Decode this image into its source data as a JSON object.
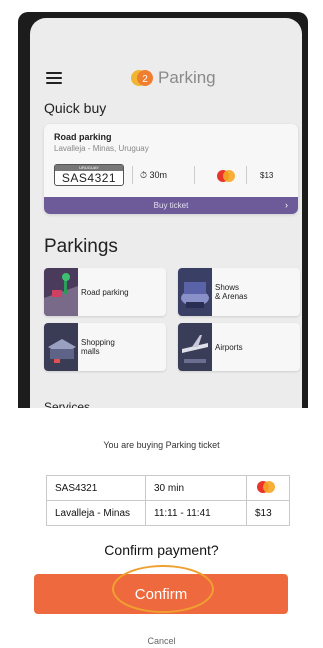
{
  "app": {
    "brand": "Parking",
    "logo_text": "T2",
    "brand_color": "#f39c2a"
  },
  "quick_buy": {
    "title": "Quick buy",
    "card": {
      "title": "Road parking",
      "subtitle": "Lavalleja - Minas, Uruguay",
      "plate_country": "URUGUAY",
      "plate": "SAS4321",
      "duration": "30m",
      "price": "$13",
      "buy_label": "Buy ticket"
    }
  },
  "parkings": {
    "title": "Parkings",
    "tiles": [
      {
        "label": "Road parking",
        "icon": "road-parking-illustration"
      },
      {
        "label": "Shows\n& Arenas",
        "icon": "arena-illustration"
      },
      {
        "label": "Shopping\nmalls",
        "icon": "mall-illustration"
      },
      {
        "label": "Airports",
        "icon": "airport-illustration"
      }
    ]
  },
  "services": {
    "title": "Services"
  },
  "sheet": {
    "title": "You are buying Parking ticket",
    "rows": [
      {
        "c1": "SAS4321",
        "c2": "30 min",
        "c3": ""
      },
      {
        "c1": "Lavalleja - Minas",
        "c2": "11:11 - 11:41",
        "c3": "$13"
      }
    ],
    "question": "Confirm payment?",
    "confirm_label": "Confirm",
    "cancel_label": "Cancel"
  },
  "colors": {
    "accent": "#ee6a3e",
    "buy_button": "#6c5a99",
    "highlight_ring": "#f0a030"
  }
}
